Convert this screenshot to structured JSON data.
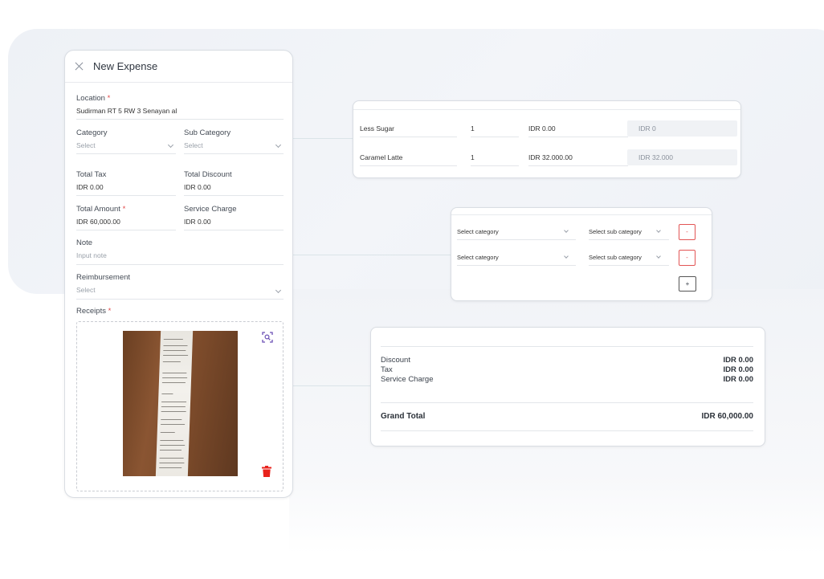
{
  "form": {
    "title": "New Expense",
    "location": {
      "label": "Location",
      "required": "*",
      "value": "Sudirman RT 5 RW 3 Senayan al"
    },
    "category": {
      "label": "Category",
      "placeholder": "Select"
    },
    "sub_category": {
      "label": "Sub Category",
      "placeholder": "Select"
    },
    "total_tax": {
      "label": "Total Tax",
      "value": "IDR 0.00"
    },
    "total_discount": {
      "label": "Total Discount",
      "value": "IDR 0.00"
    },
    "total_amount": {
      "label": "Total Amount",
      "required": "*",
      "value": "IDR 60,000.00"
    },
    "service_charge": {
      "label": "Service Charge",
      "value": "IDR 0.00"
    },
    "note": {
      "label": "Note",
      "placeholder": "Input note"
    },
    "reimbursement": {
      "label": "Reimbursement",
      "placeholder": "Select"
    },
    "receipts": {
      "label": "Receipts",
      "required": "*"
    }
  },
  "items": [
    {
      "name": "Less Sugar",
      "qty": "1",
      "price": "IDR 0.00",
      "total": "IDR 0"
    },
    {
      "name": "Caramel Latte",
      "qty": "1",
      "price": "IDR 32.000.00",
      "total": "IDR 32.000"
    }
  ],
  "category_rows": [
    {
      "category": "Select category",
      "sub_category": "Select sub category",
      "remove": "-"
    },
    {
      "category": "Select category",
      "sub_category": "Select sub category",
      "remove": "-"
    }
  ],
  "add_label": "+",
  "summary": {
    "discount": {
      "label": "Discount",
      "value": "IDR 0.00"
    },
    "tax": {
      "label": "Tax",
      "value": "IDR 0.00"
    },
    "service_charge": {
      "label": "Service Charge",
      "value": "IDR 0.00"
    },
    "grand_total": {
      "label": "Grand Total",
      "value": "IDR 60,000.00"
    }
  },
  "colors": {
    "required": "#e04848",
    "delete": "#e8231c",
    "border": "#d9dde3",
    "background": "#eef1f6"
  },
  "icons": [
    "close-icon",
    "zoom-icon",
    "trash-icon",
    "chevron-down-icon"
  ]
}
